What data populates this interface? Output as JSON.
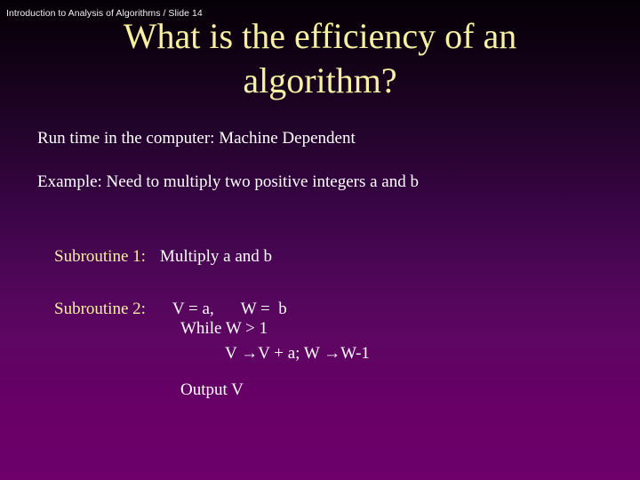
{
  "slide": {
    "header": "Introduction to Analysis of Algorithms / Slide 14",
    "title": "What is the efficiency of an algorithm?",
    "title_line1": "What is the efficiency of an",
    "title_line2": "algorithm?",
    "colors": {
      "accent_yellow": "#f7f0a3",
      "body_white": "#ffffff",
      "background_top": "#050006",
      "background_bottom": "#6d006b"
    },
    "body": {
      "runtime": "Run time in the computer: Machine Dependent",
      "example": "Example: Need to multiply two positive integers a and b",
      "subroutine1_label": "Subroutine 1:",
      "subroutine1_text": "Multiply a and b",
      "subroutine2_label": "Subroutine 2:",
      "subroutine2_assign_v": "V = a,",
      "subroutine2_assign_w": "W =  b",
      "while_condition": "While W > 1",
      "while_body": "V →V + a; W →W-1",
      "output": "Output V"
    }
  }
}
